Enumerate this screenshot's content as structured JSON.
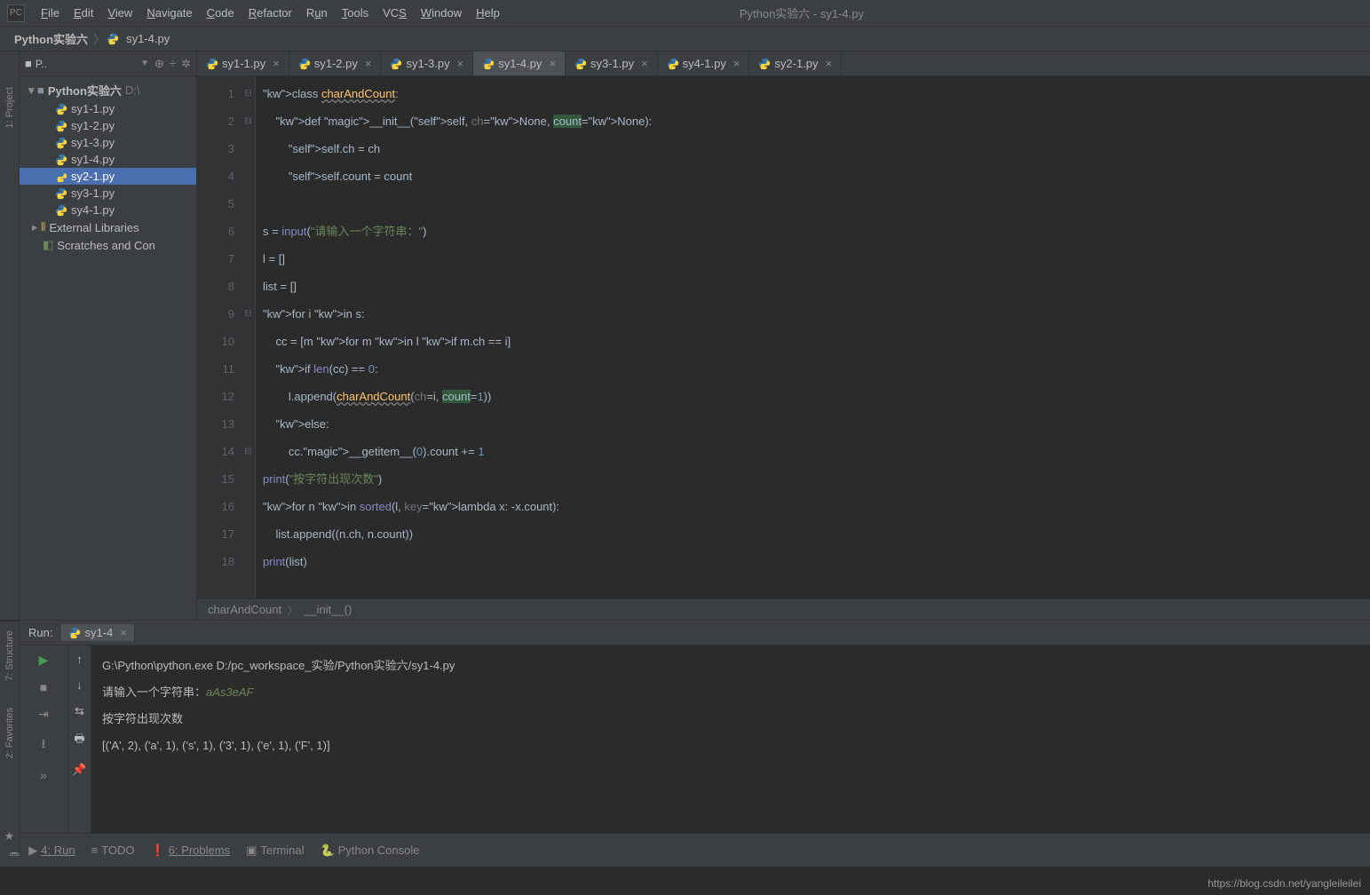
{
  "window_title": "Python实验六 - sy1-4.py",
  "menu": [
    "File",
    "Edit",
    "View",
    "Navigate",
    "Code",
    "Refactor",
    "Run",
    "Tools",
    "VCS",
    "Window",
    "Help"
  ],
  "breadcrumb": {
    "project": "Python实验六",
    "file": "sy1-4.py"
  },
  "project_panel": {
    "title": "P..",
    "root": {
      "name": "Python实验六",
      "path": "D:\\"
    },
    "files": [
      "sy1-1.py",
      "sy1-2.py",
      "sy1-3.py",
      "sy1-4.py",
      "sy2-1.py",
      "sy3-1.py",
      "sy4-1.py"
    ],
    "selected": "sy2-1.py",
    "external": "External Libraries",
    "scratches": "Scratches and Con"
  },
  "tabs": [
    {
      "name": "sy1-1.py",
      "active": false
    },
    {
      "name": "sy1-2.py",
      "active": false
    },
    {
      "name": "sy1-3.py",
      "active": false
    },
    {
      "name": "sy1-4.py",
      "active": true
    },
    {
      "name": "sy3-1.py",
      "active": false
    },
    {
      "name": "sy4-1.py",
      "active": false
    },
    {
      "name": "sy2-1.py",
      "active": false
    }
  ],
  "code_lines": [
    "class charAndCount:",
    "    def __init__(self, ch=None, count=None):",
    "        self.ch = ch",
    "        self.count = count",
    "",
    "s = input(\"请输入一个字符串：\")",
    "l = []",
    "list = []",
    "for i in s:",
    "    cc = [m for m in l if m.ch == i]",
    "    if len(cc) == 0:",
    "        l.append(charAndCount(ch=i, count=1))",
    "    else:",
    "        cc.__getitem__(0).count += 1",
    "print(\"按字符出现次数\")",
    "for n in sorted(l, key=lambda x: -x.count):",
    "    list.append((n.ch, n.count))",
    "print(list)"
  ],
  "breadcrumb_bottom": [
    "charAndCount",
    "__init__()"
  ],
  "run": {
    "label": "Run:",
    "tab": "sy1-4",
    "output": {
      "cmd": "G:\\Python\\python.exe D:/pc_workspace_实验/Python实验六/sy1-4.py",
      "prompt": "请输入一个字符串：",
      "input": "aAs3eAF",
      "line2": "按字符出现次数",
      "result": "[('A', 2), ('a', 1), ('s', 1), ('3', 1), ('e', 1), ('F', 1)]"
    }
  },
  "statusbar": {
    "run": "4: Run",
    "todo": "TODO",
    "problems": "6: Problems",
    "terminal": "Terminal",
    "console": "Python Console"
  },
  "left_tools": [
    "1: Project",
    "7: Structure",
    "2: Favorites"
  ],
  "watermark": "https://blog.csdn.net/yangleileilei"
}
